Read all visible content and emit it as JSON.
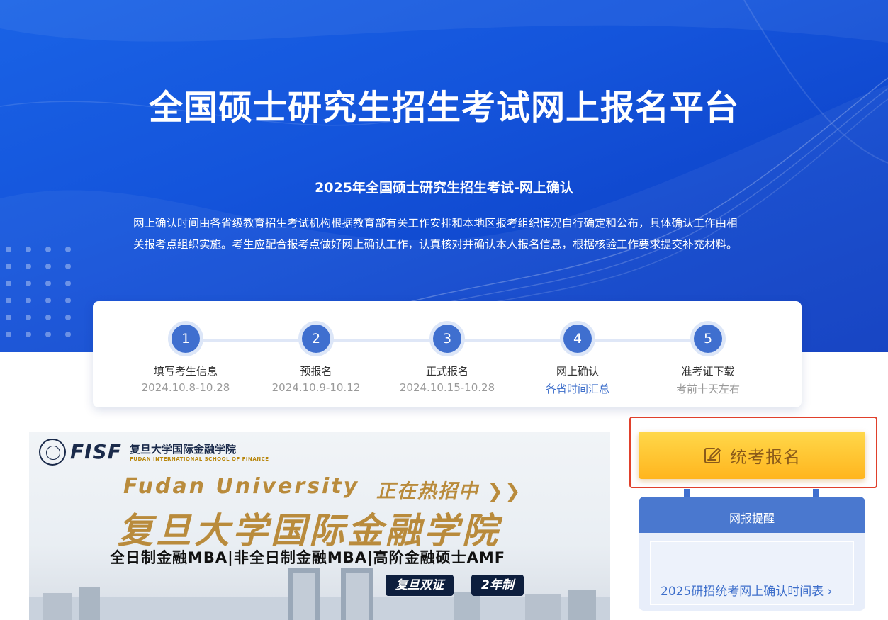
{
  "hero": {
    "title": "全国硕士研究生招生考试网上报名平台",
    "subtitle": "2025年全国硕士研究生招生考试-网上确认",
    "description_line1": "网上确认时间由各省级教育招生考试机构根据教育部有关工作安排和本地区报考组织情况自行确定和公布，具体确认工作由相",
    "description_line2": "关报考点组织实施。考生应配合报考点做好网上确认工作，认真核对并确认本人报名信息，根据核验工作要求提交补充材料。"
  },
  "steps": [
    {
      "number": "1",
      "label": "填写考生信息",
      "date": "2024.10.8-10.28"
    },
    {
      "number": "2",
      "label": "预报名",
      "date": "2024.10.9-10.12"
    },
    {
      "number": "3",
      "label": "正式报名",
      "date": "2024.10.15-10.28"
    },
    {
      "number": "4",
      "label": "网上确认",
      "date": "各省时间汇总"
    },
    {
      "number": "5",
      "label": "准考证下载",
      "date": "考前十天左右"
    }
  ],
  "banner": {
    "logo_text": "FISF",
    "school_cn": "复旦大学国际金融学院",
    "school_en": "FUDAN INTERNATIONAL SCHOOL OF FINANCE",
    "headline_en": "Fudan University",
    "hot": "正在热招中 ❯❯",
    "headline_cn": "复旦大学国际金融学院",
    "programs": "全日制金融MBA|非全日制金融MBA|高阶金融硕士AMF",
    "tag1": "复旦双证",
    "tag2": "2年制"
  },
  "register_button": {
    "label": "统考报名",
    "icon": "edit-icon"
  },
  "reminder": {
    "title": "网报提醒",
    "link": "2025研招统考网上确认时间表 ›"
  },
  "colors": {
    "hero_blue": "#1454db",
    "step_circle": "#3f6fcf",
    "button_gold": "#ffc72e",
    "highlight_red": "#e0402b",
    "link_blue": "#3e6fcb"
  }
}
